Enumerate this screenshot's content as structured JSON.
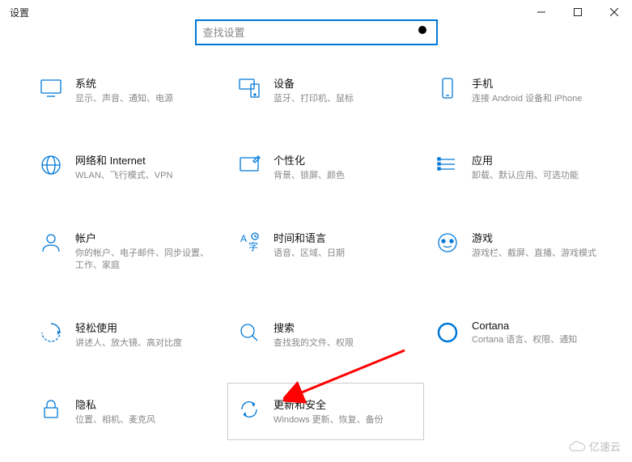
{
  "window": {
    "title": "设置"
  },
  "search": {
    "placeholder": "查找设置"
  },
  "tiles": {
    "system": {
      "title": "系统",
      "desc": "显示、声音、通知、电源"
    },
    "devices": {
      "title": "设备",
      "desc": "蓝牙、打印机、鼠标"
    },
    "phone": {
      "title": "手机",
      "desc": "连接 Android 设备和 iPhone"
    },
    "network": {
      "title": "网络和 Internet",
      "desc": "WLAN、飞行模式、VPN"
    },
    "personal": {
      "title": "个性化",
      "desc": "背景、锁屏、颜色"
    },
    "apps": {
      "title": "应用",
      "desc": "卸载、默认应用、可选功能"
    },
    "accounts": {
      "title": "帐户",
      "desc": "你的帐户、电子邮件、同步设置、工作、家庭"
    },
    "time": {
      "title": "时间和语言",
      "desc": "语音、区域、日期"
    },
    "gaming": {
      "title": "游戏",
      "desc": "游戏栏、截屏、直播、游戏模式"
    },
    "ease": {
      "title": "轻松使用",
      "desc": "讲述人、放大镜、高对比度"
    },
    "searchcat": {
      "title": "搜索",
      "desc": "查找我的文件、权限"
    },
    "cortana": {
      "title": "Cortana",
      "desc": "Cortana 语言、权限、通知"
    },
    "privacy": {
      "title": "隐私",
      "desc": "位置、相机、麦克风"
    },
    "update": {
      "title": "更新和安全",
      "desc": "Windows 更新、恢复、备份"
    }
  },
  "watermark": {
    "text": "亿速云"
  }
}
